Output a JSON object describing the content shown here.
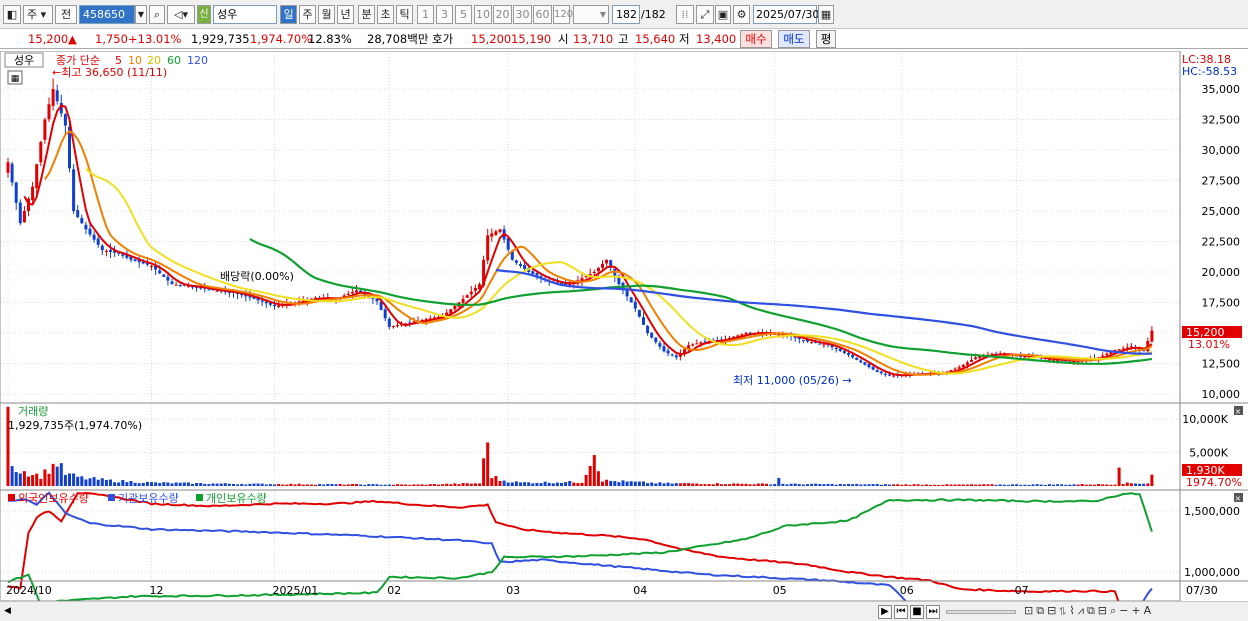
{
  "toolbar": {
    "type1": "주",
    "type2": "전",
    "code": "458650",
    "name": "성우",
    "new_badge": "신",
    "periods": [
      "일",
      "주",
      "월",
      "년",
      "분",
      "초",
      "틱"
    ],
    "counts": [
      "1",
      "3",
      "5",
      "10",
      "20",
      "30",
      "60",
      "120"
    ],
    "range": "182",
    "range_total": "/182",
    "date": "2025/07/30"
  },
  "quote": {
    "price": "15,200",
    "arrow": "▲",
    "change": "1,750",
    "pct": "+13.01%",
    "volume": "1,929,735",
    "vol_pct": "1,974.70%",
    "turnover_rate": "12.83%",
    "amount": "28,708백만",
    "hoga_label": "호가",
    "ask": "15,200",
    "bid": "15,190",
    "open_label": "시",
    "open": "13,710",
    "high_label": "고",
    "high": "15,640",
    "low_label": "저",
    "low": "13,400",
    "buy": "매수",
    "sell": "매도",
    "eval": "평"
  },
  "price_panel": {
    "stock_tag": "성우",
    "ma_label": "종가 단순",
    "ma_periods": [
      "5",
      "10",
      "20",
      "60",
      "120"
    ],
    "ma_colors": [
      "#e00000",
      "#f08000",
      "#f0e020",
      "#10a030",
      "#3050e0"
    ],
    "max_note": "최고 36,650 (11/11)",
    "min_note": "최저 11,000 (05/26)",
    "div_note": "배당락(0.00%)",
    "lc": "LC:38.18",
    "hc": "HC:-58.53",
    "y_labels": [
      "35,000",
      "32,500",
      "30,000",
      "27,500",
      "25,000",
      "22,500",
      "20,000",
      "17,500",
      "15,000",
      "12,500",
      "10,000"
    ],
    "cur_price": "15,200",
    "cur_pct": "13.01%"
  },
  "volume_panel": {
    "title": "거래량",
    "info": "1,929,735주(1,974.70%)",
    "y_labels": [
      "10,000K",
      "5,000K"
    ],
    "cur_vol": "1,930K",
    "cur_pct": "1974.70%"
  },
  "holding_panel": {
    "legend": [
      "외국인보유수량",
      "기관보유수량",
      "개인보유수량"
    ],
    "colors": [
      "#e00000",
      "#3050e0",
      "#10a030"
    ],
    "y_labels": [
      "1,500,000",
      "1,000,000"
    ]
  },
  "x_labels": [
    "2024/10",
    "12",
    "2025/01",
    "02",
    "03",
    "04",
    "05",
    "06",
    "07",
    "07/30"
  ],
  "colors": {
    "up": "#e00000",
    "down": "#1040d0",
    "accent": "#3173c7"
  },
  "chart_data": {
    "type": "candlestick",
    "ylim": [
      10000,
      37000
    ],
    "x_ticks": [
      {
        "label": "2024/10",
        "i": 0
      },
      {
        "label": "12",
        "i": 35
      },
      {
        "label": "2025/01",
        "i": 65
      },
      {
        "label": "02",
        "i": 93
      },
      {
        "label": "03",
        "i": 122
      },
      {
        "label": "04",
        "i": 153
      },
      {
        "label": "05",
        "i": 187
      },
      {
        "label": "06",
        "i": 218
      },
      {
        "label": "07",
        "i": 246
      }
    ],
    "close_anchors": [
      [
        0,
        29000
      ],
      [
        3,
        24000
      ],
      [
        6,
        27000
      ],
      [
        9,
        32500
      ],
      [
        11,
        35000
      ],
      [
        14,
        32000
      ],
      [
        16,
        25000
      ],
      [
        19,
        23500
      ],
      [
        23,
        21800
      ],
      [
        27,
        21500
      ],
      [
        30,
        21000
      ],
      [
        35,
        20500
      ],
      [
        40,
        19000
      ],
      [
        45,
        18800
      ],
      [
        50,
        18500
      ],
      [
        55,
        18300
      ],
      [
        60,
        17800
      ],
      [
        65,
        17200
      ],
      [
        70,
        17500
      ],
      [
        75,
        17900
      ],
      [
        80,
        17800
      ],
      [
        85,
        18500
      ],
      [
        90,
        17600
      ],
      [
        93,
        15500
      ],
      [
        100,
        16000
      ],
      [
        106,
        16400
      ],
      [
        110,
        17500
      ],
      [
        115,
        19000
      ],
      [
        117,
        23000
      ],
      [
        120,
        23500
      ],
      [
        123,
        21000
      ],
      [
        127,
        20000
      ],
      [
        132,
        19200
      ],
      [
        137,
        19000
      ],
      [
        140,
        19500
      ],
      [
        143,
        20000
      ],
      [
        146,
        21000
      ],
      [
        149,
        19000
      ],
      [
        153,
        17000
      ],
      [
        156,
        15000
      ],
      [
        160,
        13500
      ],
      [
        163,
        13000
      ],
      [
        166,
        14000
      ],
      [
        170,
        14300
      ],
      [
        175,
        14500
      ],
      [
        180,
        15000
      ],
      [
        185,
        15000
      ],
      [
        190,
        14800
      ],
      [
        195,
        14300
      ],
      [
        200,
        14000
      ],
      [
        205,
        13200
      ],
      [
        208,
        12600
      ],
      [
        212,
        11800
      ],
      [
        215,
        11500
      ],
      [
        220,
        11600
      ],
      [
        225,
        11700
      ],
      [
        228,
        11700
      ],
      [
        232,
        12200
      ],
      [
        236,
        13000
      ],
      [
        240,
        13300
      ],
      [
        245,
        13200
      ],
      [
        250,
        13000
      ],
      [
        255,
        12800
      ],
      [
        260,
        12700
      ],
      [
        266,
        13000
      ],
      [
        270,
        13600
      ],
      [
        274,
        13900
      ],
      [
        277,
        13500
      ],
      [
        279,
        15200
      ]
    ],
    "volume_anchors": [
      [
        0,
        9500
      ],
      [
        1,
        4000
      ],
      [
        2,
        2500
      ],
      [
        4,
        2200
      ],
      [
        6,
        1800
      ],
      [
        8,
        1500
      ],
      [
        10,
        2500
      ],
      [
        12,
        3500
      ],
      [
        14,
        1800
      ],
      [
        18,
        1200
      ],
      [
        25,
        800
      ],
      [
        35,
        500
      ],
      [
        45,
        400
      ],
      [
        60,
        300
      ],
      [
        80,
        250
      ],
      [
        100,
        200
      ],
      [
        115,
        400
      ],
      [
        117,
        6500
      ],
      [
        118,
        1500
      ],
      [
        120,
        900
      ],
      [
        125,
        500
      ],
      [
        140,
        600
      ],
      [
        143,
        5200
      ],
      [
        145,
        800
      ],
      [
        160,
        400
      ],
      [
        187,
        300
      ],
      [
        188,
        1300
      ],
      [
        189,
        300
      ],
      [
        230,
        200
      ],
      [
        270,
        250
      ],
      [
        271,
        3800
      ],
      [
        272,
        400
      ],
      [
        278,
        400
      ],
      [
        279,
        1930
      ]
    ],
    "foreign": [
      [
        0,
        880000
      ],
      [
        3,
        870000
      ],
      [
        5,
        1320000
      ],
      [
        7,
        1450000
      ],
      [
        10,
        1500000
      ],
      [
        13,
        1420000
      ],
      [
        17,
        1650000
      ],
      [
        25,
        1620000
      ],
      [
        35,
        1560000
      ],
      [
        50,
        1540000
      ],
      [
        65,
        1560000
      ],
      [
        80,
        1560000
      ],
      [
        90,
        1580000
      ],
      [
        100,
        1550000
      ],
      [
        110,
        1530000
      ],
      [
        117,
        1550000
      ],
      [
        119,
        1410000
      ],
      [
        125,
        1350000
      ],
      [
        135,
        1320000
      ],
      [
        145,
        1300000
      ],
      [
        155,
        1270000
      ],
      [
        165,
        1180000
      ],
      [
        175,
        1120000
      ],
      [
        185,
        1090000
      ],
      [
        195,
        1060000
      ],
      [
        205,
        1000000
      ],
      [
        215,
        960000
      ],
      [
        225,
        930000
      ],
      [
        232,
        860000
      ],
      [
        240,
        850000
      ],
      [
        250,
        840000
      ],
      [
        260,
        845000
      ],
      [
        270,
        840000
      ],
      [
        271,
        740000
      ],
      [
        277,
        720000
      ],
      [
        279,
        730000
      ]
    ],
    "institution": [
      [
        0,
        1580000
      ],
      [
        4,
        1600000
      ],
      [
        7,
        1550000
      ],
      [
        10,
        1650000
      ],
      [
        14,
        1480000
      ],
      [
        20,
        1400000
      ],
      [
        35,
        1350000
      ],
      [
        60,
        1330000
      ],
      [
        85,
        1300000
      ],
      [
        110,
        1260000
      ],
      [
        118,
        1230000
      ],
      [
        120,
        1080000
      ],
      [
        130,
        1100000
      ],
      [
        150,
        1040000
      ],
      [
        170,
        980000
      ],
      [
        200,
        930000
      ],
      [
        215,
        890000
      ],
      [
        220,
        730000
      ],
      [
        240,
        710000
      ],
      [
        265,
        700000
      ],
      [
        272,
        700000
      ],
      [
        276,
        720000
      ],
      [
        279,
        870000
      ]
    ],
    "individual": [
      [
        0,
        920000
      ],
      [
        5,
        980000
      ],
      [
        8,
        730000
      ],
      [
        12,
        760000
      ],
      [
        30,
        800000
      ],
      [
        60,
        810000
      ],
      [
        90,
        830000
      ],
      [
        93,
        960000
      ],
      [
        110,
        950000
      ],
      [
        118,
        1000000
      ],
      [
        121,
        1120000
      ],
      [
        140,
        1130000
      ],
      [
        160,
        1160000
      ],
      [
        180,
        1270000
      ],
      [
        190,
        1380000
      ],
      [
        205,
        1420000
      ],
      [
        215,
        1590000
      ],
      [
        235,
        1590000
      ],
      [
        250,
        1580000
      ],
      [
        265,
        1580000
      ],
      [
        272,
        1640000
      ],
      [
        276,
        1640000
      ],
      [
        279,
        1330000
      ]
    ]
  }
}
